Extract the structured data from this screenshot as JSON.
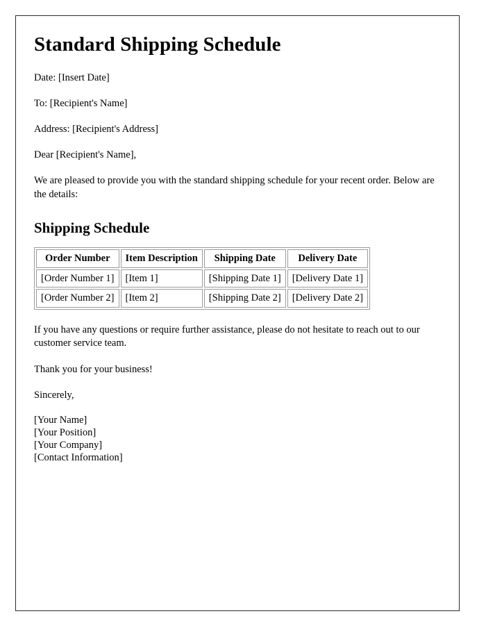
{
  "document": {
    "title": "Standard Shipping Schedule",
    "meta_lines": [
      "Date: [Insert Date]",
      "To: [Recipient's Name]",
      "Address: [Recipient's Address]"
    ],
    "salutation": "Dear [Recipient's Name],",
    "intro_paragraph": "We are pleased to provide you with the standard shipping schedule for your recent order. Below are the details:",
    "section_heading": "Shipping Schedule",
    "table": {
      "headers": [
        "Order Number",
        "Item Description",
        "Shipping Date",
        "Delivery Date"
      ],
      "rows": [
        [
          "[Order Number 1]",
          "[Item 1]",
          "[Shipping Date 1]",
          "[Delivery Date 1]"
        ],
        [
          "[Order Number 2]",
          "[Item 2]",
          "[Shipping Date 2]",
          "[Delivery Date 2]"
        ]
      ]
    },
    "closing_paragraph": "If you have any questions or require further assistance, please do not hesitate to reach out to our customer service team.",
    "thanks_line": "Thank you for your business!",
    "sign_off": "Sincerely,",
    "signature": {
      "name": "[Your Name]",
      "position": "[Your Position]",
      "company": "[Your Company]",
      "contact": "[Contact Information]"
    }
  }
}
